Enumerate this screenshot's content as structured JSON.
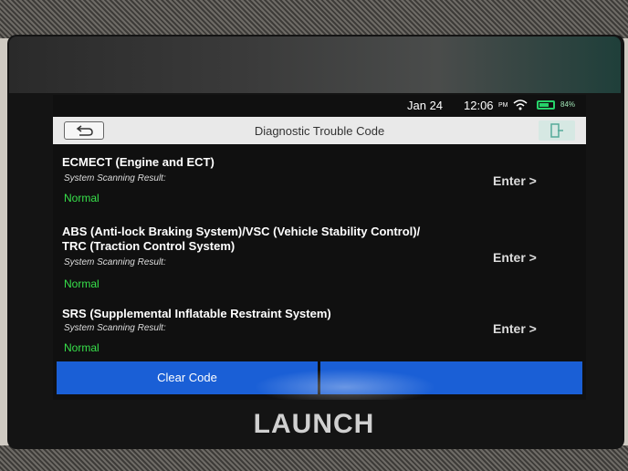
{
  "status_bar": {
    "date": "Jan 24",
    "time": "12:06",
    "ampm": "PM",
    "battery": "84%"
  },
  "header": {
    "title": "Diagnostic Trouble Code"
  },
  "systems": [
    {
      "name_lines": [
        "ECMECT (Engine and ECT)"
      ],
      "result_label": "System Scanning Result:",
      "status": "Normal",
      "enter_label": "Enter >"
    },
    {
      "name_lines": [
        "ABS (Anti-lock Braking System)/VSC (Vehicle Stability Control)/",
        "TRC (Traction Control System)"
      ],
      "result_label": "System Scanning Result:",
      "status": "Normal",
      "enter_label": "Enter >"
    },
    {
      "name_lines": [
        "SRS (Supplemental Inflatable Restraint System)"
      ],
      "result_label": "System Scanning Result:",
      "status": "Normal",
      "enter_label": "Enter >"
    }
  ],
  "footer": {
    "clear_code_label": "Clear Code"
  },
  "device": {
    "brand": "LAUNCH"
  },
  "colors": {
    "accent_blue": "#1a5fd6",
    "status_normal": "#37e04a"
  }
}
